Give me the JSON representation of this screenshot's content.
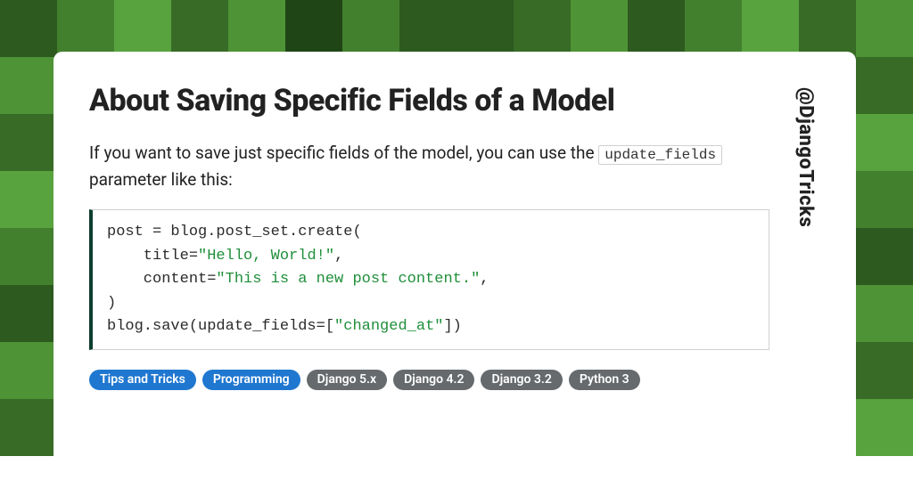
{
  "title": "About Saving Specific Fields of a Model",
  "intro_before": "If you want to save just specific fields of the model, you can use the ",
  "intro_code": "update_fields",
  "intro_after": " parameter like this:",
  "code": {
    "line1": "post = blog.post_set.create(",
    "line2_a": "    title=",
    "line2_b": "\"Hello, World!\"",
    "line2_c": ",",
    "line3_a": "    content=",
    "line3_b": "\"This is a new post content.\"",
    "line3_c": ",",
    "line4": ")",
    "line5_a": "blog.save(update_fields=[",
    "line5_b": "\"changed_at\"",
    "line5_c": "])"
  },
  "tags": {
    "t0": "Tips and Tricks",
    "t1": "Programming",
    "t2": "Django 5.x",
    "t3": "Django 4.2",
    "t4": "Django 3.2",
    "t5": "Python 3"
  },
  "handle": "@DjangoTricks"
}
